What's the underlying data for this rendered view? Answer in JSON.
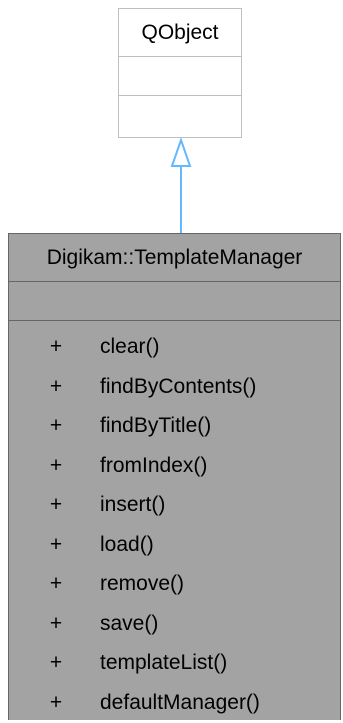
{
  "parent_class": {
    "name": "QObject",
    "attributes": [],
    "methods": []
  },
  "relationship": {
    "type": "inheritance",
    "from": "Digikam::TemplateManager",
    "to": "QObject",
    "arrow_color": "#63b8ff"
  },
  "class": {
    "name": "Digikam::TemplateManager",
    "attributes": [],
    "methods": [
      {
        "visibility": "+",
        "name": "clear()"
      },
      {
        "visibility": "+",
        "name": "findByContents()"
      },
      {
        "visibility": "+",
        "name": "findByTitle()"
      },
      {
        "visibility": "+",
        "name": "fromIndex()"
      },
      {
        "visibility": "+",
        "name": "insert()"
      },
      {
        "visibility": "+",
        "name": "load()"
      },
      {
        "visibility": "+",
        "name": "remove()"
      },
      {
        "visibility": "+",
        "name": "save()"
      },
      {
        "visibility": "+",
        "name": "templateList()"
      },
      {
        "visibility": "+",
        "name": "defaultManager()"
      }
    ]
  },
  "colors": {
    "parent_border": "#bfbfbf",
    "class_fill": "#a3a3a3",
    "class_border": "#666666"
  }
}
